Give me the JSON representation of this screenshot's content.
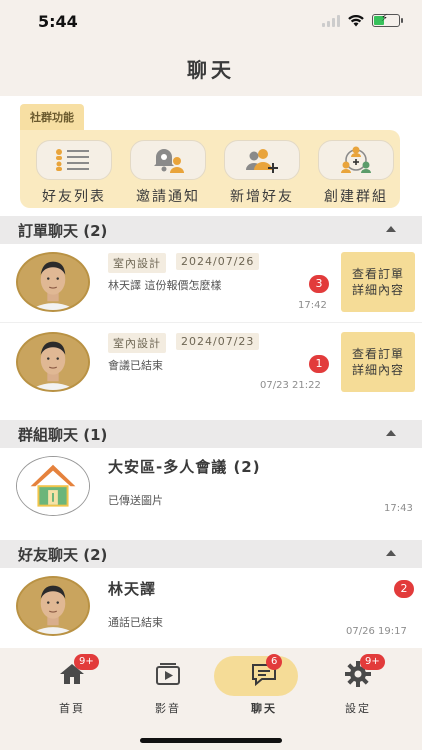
{
  "status_bar": {
    "time": "5:44"
  },
  "header": {
    "title": "聊天"
  },
  "community": {
    "tag": "社群功能",
    "items": [
      {
        "label": "好友列表",
        "icon": "friend-list-icon"
      },
      {
        "label": "邀請通知",
        "icon": "invite-notification-icon"
      },
      {
        "label": "新增好友",
        "icon": "add-friend-icon"
      },
      {
        "label": "創建群組",
        "icon": "create-group-icon"
      }
    ]
  },
  "order_chats": {
    "title": "訂單聊天 (2)",
    "items": [
      {
        "tag": "室內設計",
        "date": "2024/07/26",
        "message": "林天譯 這份報價怎麼樣",
        "badge": "3",
        "time": "17:42",
        "button": "查看訂單\n詳細內容"
      },
      {
        "tag": "室內設計",
        "date": "2024/07/23",
        "message": "會議已結束",
        "badge": "1",
        "time": "07/23 21:22",
        "button": "查看訂單\n詳細內容"
      }
    ]
  },
  "group_chats": {
    "title": "群組聊天 (1)",
    "items": [
      {
        "name": "大安區-多人會議 (2)",
        "message": "已傳送圖片",
        "time": "17:43"
      }
    ]
  },
  "friend_chats": {
    "title": "好友聊天 (2)",
    "items": [
      {
        "name": "林天譯",
        "message": "通話已結束",
        "badge": "2",
        "time": "07/26 19:17"
      }
    ]
  },
  "tabbar": {
    "items": [
      {
        "label": "首頁",
        "badge": "9+",
        "icon": "home-icon"
      },
      {
        "label": "影音",
        "badge": "",
        "icon": "video-icon"
      },
      {
        "label": "聊天",
        "badge": "6",
        "icon": "chat-icon",
        "active": true
      },
      {
        "label": "設定",
        "badge": "9+",
        "icon": "gear-icon"
      }
    ]
  },
  "colors": {
    "accent": "#f5dc97",
    "badge": "#e23b3b",
    "background": "#f5f0eb"
  }
}
